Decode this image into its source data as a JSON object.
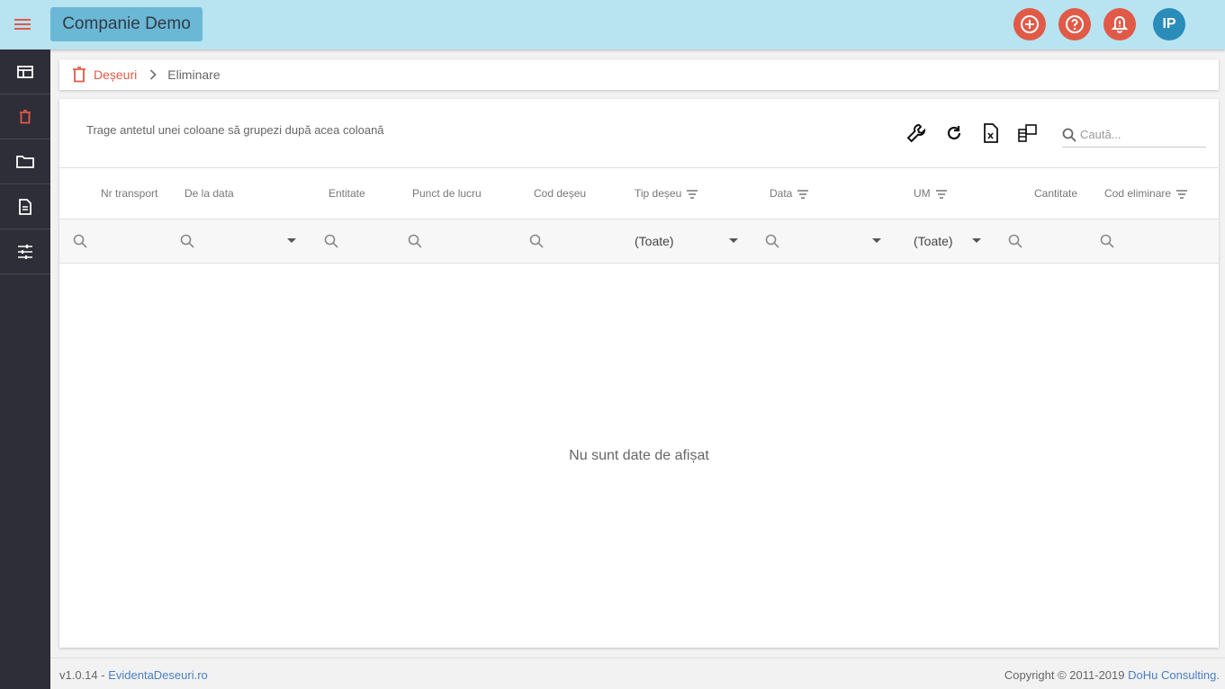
{
  "app": {
    "company_name": "Companie Demo",
    "user_initials": "IP",
    "accent_color": "#e05a47",
    "topbar_color": "#b8e3f1",
    "sidebar_color": "#2e2e38"
  },
  "topbar": {
    "buttons": [
      {
        "icon": "add-circle-icon"
      },
      {
        "icon": "help-circle-icon"
      },
      {
        "icon": "bell-alert-icon"
      }
    ]
  },
  "sidebar": {
    "items": [
      {
        "icon": "dashboard-icon"
      },
      {
        "icon": "trash-icon",
        "active": true
      },
      {
        "icon": "folder-icon"
      },
      {
        "icon": "document-icon"
      },
      {
        "icon": "sliders-icon"
      }
    ]
  },
  "breadcrumb": {
    "parent": "Deșeuri",
    "current": "Eliminare"
  },
  "grid": {
    "group_hint": "Trage antetul unei coloane să grupezi după acea coloană",
    "search_placeholder": "Caută...",
    "columns": [
      {
        "label": "Nr transport"
      },
      {
        "label": "De la data"
      },
      {
        "label": "Entitate"
      },
      {
        "label": "Punct de lucru"
      },
      {
        "label": "Cod deșeu"
      },
      {
        "label": "Tip deșeu",
        "filter": true
      },
      {
        "label": "Data",
        "filter": true
      },
      {
        "label": "UM",
        "filter": true
      },
      {
        "label": "Cantitate"
      },
      {
        "label": "Cod eliminare",
        "filter": true
      }
    ],
    "filters": {
      "tip_deseu": "(Toate)",
      "um": "(Toate)"
    },
    "empty_message": "Nu sunt date de afișat"
  },
  "footer": {
    "version": "v1.0.14 - ",
    "site_link": "EvidentaDeseuri.ro",
    "copyright": "Copyright © 2011-2019 ",
    "company_link": "DoHu Consulting."
  }
}
